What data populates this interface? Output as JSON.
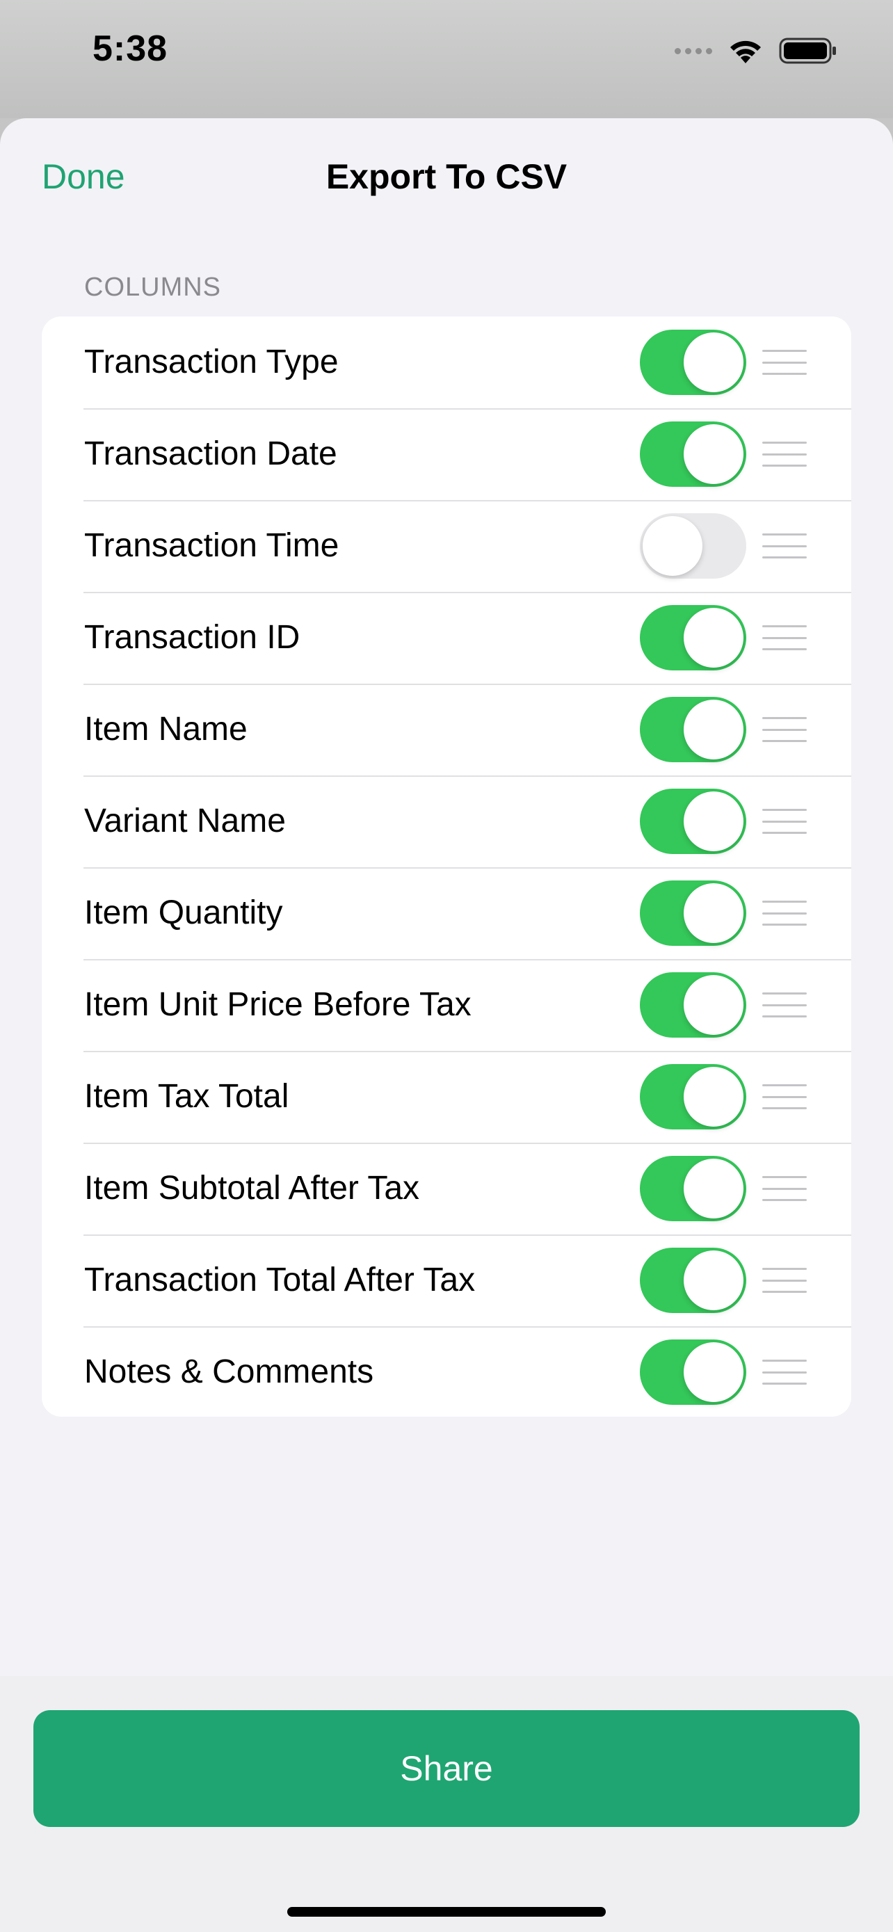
{
  "status_bar": {
    "time": "5:38",
    "icons": [
      "cellular-signal-icon",
      "wifi-icon",
      "battery-icon"
    ]
  },
  "nav": {
    "done_label": "Done",
    "title": "Export To CSV"
  },
  "section": {
    "header": "COLUMNS"
  },
  "columns": [
    {
      "label": "Transaction Type",
      "enabled": true
    },
    {
      "label": "Transaction Date",
      "enabled": true
    },
    {
      "label": "Transaction Time",
      "enabled": false
    },
    {
      "label": "Transaction ID",
      "enabled": true
    },
    {
      "label": "Item Name",
      "enabled": true
    },
    {
      "label": "Variant Name",
      "enabled": true
    },
    {
      "label": "Item Quantity",
      "enabled": true
    },
    {
      "label": "Item Unit Price Before Tax",
      "enabled": true
    },
    {
      "label": "Item Tax Total",
      "enabled": true
    },
    {
      "label": "Item Subtotal After Tax",
      "enabled": true
    },
    {
      "label": "Transaction Total After Tax",
      "enabled": true
    },
    {
      "label": "Notes & Comments",
      "enabled": true
    }
  ],
  "share_label": "Share",
  "colors": {
    "accent": "#1fa572",
    "toggle_on": "#34c759",
    "toggle_off": "#e9e9eb"
  }
}
